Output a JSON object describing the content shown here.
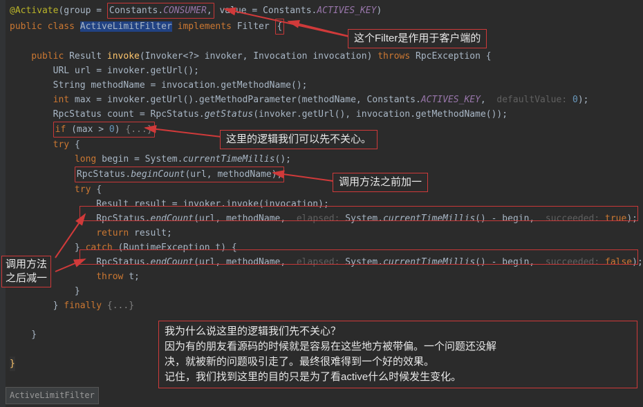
{
  "code": {
    "l1a": "@Activate",
    "l1b": "(group = ",
    "l1c": "Constants.",
    "l1d": "CONSUMER",
    "l1e": ", value = Constants.",
    "l1f": "ACTIVES_KEY",
    "l1g": ")",
    "l2a": "public class ",
    "l2b": "ActiveLimitFilter",
    "l2c": " implements ",
    "l2d": "Filter ",
    "l2e": "{",
    "l4a": "    public ",
    "l4b": "Result ",
    "l4c": "invoke",
    "l4d": "(Invoker<?> invoker, Invocation invocation) ",
    "l4e": "throws ",
    "l4f": "RpcException {",
    "l5a": "        URL url = invoker.getUrl();",
    "l6a": "        String methodName = invocation.getMethodName();",
    "l7a": "        int ",
    "l7b": "max = invoker.getUrl().getMethodParameter(methodName, Constants.",
    "l7c": "ACTIVES_KEY",
    "l7d": ", ",
    "l7hint": " defaultValue: ",
    "l7e": "0",
    "l7f": ");",
    "l8a": "        RpcStatus count = RpcStatus.",
    "l8b": "getStatus",
    "l8c": "(invoker.getUrl(), invocation.getMethodName());",
    "l9a": "        if ",
    "l9b": "(max > ",
    "l9c": "0",
    "l9d": ") ",
    "l9fold": "{...}",
    "l10a": "        try ",
    "l10b": "{",
    "l11a": "            long ",
    "l11b": "begin = System.",
    "l11c": "currentTimeMillis",
    "l11d": "();",
    "l12a": "            RpcStatus.",
    "l12b": "beginCount",
    "l12c": "(url, methodName);",
    "l13a": "            try ",
    "l13b": "{",
    "l14a": "                Result result = invoker.invoke(invocation);",
    "l15a": "                RpcStatus.",
    "l15b": "endCount",
    "l15c": "(url, methodName, ",
    "l15hint": " elapsed: ",
    "l15d": "System.",
    "l15e": "currentTimeMillis",
    "l15f": "() - begin, ",
    "l15hint2": " succeeded: ",
    "l15g": "true",
    "l15h": ");",
    "l16a": "                return ",
    "l16b": "result;",
    "l17a": "            } ",
    "l17b": "catch ",
    "l17c": "(RuntimeException t) {",
    "l18a": "                RpcStatus.",
    "l18b": "endCount",
    "l18c": "(url, methodName, ",
    "l18hint": " elapsed: ",
    "l18d": "System.",
    "l18e": "currentTimeMillis",
    "l18f": "() - begin, ",
    "l18hint2": " succeeded: ",
    "l18g": "false",
    "l18h": ");",
    "l19a": "                throw ",
    "l19b": "t;",
    "l20a": "            }",
    "l21a": "        } ",
    "l21b": "finally ",
    "l21fold": "{...}",
    "l24a": "}",
    "l25a": "}"
  },
  "callouts": {
    "c1": "这个Filter是作用于客户端的",
    "c2": "这里的逻辑我们可以先不关心。",
    "c3": "调用方法之前加一",
    "c4_l1": "调用方法",
    "c4_l2": "之后减一",
    "c5_l1": "我为什么说这里的逻辑我们先不关心？",
    "c5_l2": "因为有的朋友看源码的时候就是容易在这些地方被带偏。一个问题还没解",
    "c5_l3": "决，就被新的问题吸引走了。最终很难得到一个好的效果。",
    "c5_l4": "记住，我们找到这里的目的只是为了看active什么时候发生变化。"
  },
  "breadcrumb": "ActiveLimitFilter"
}
